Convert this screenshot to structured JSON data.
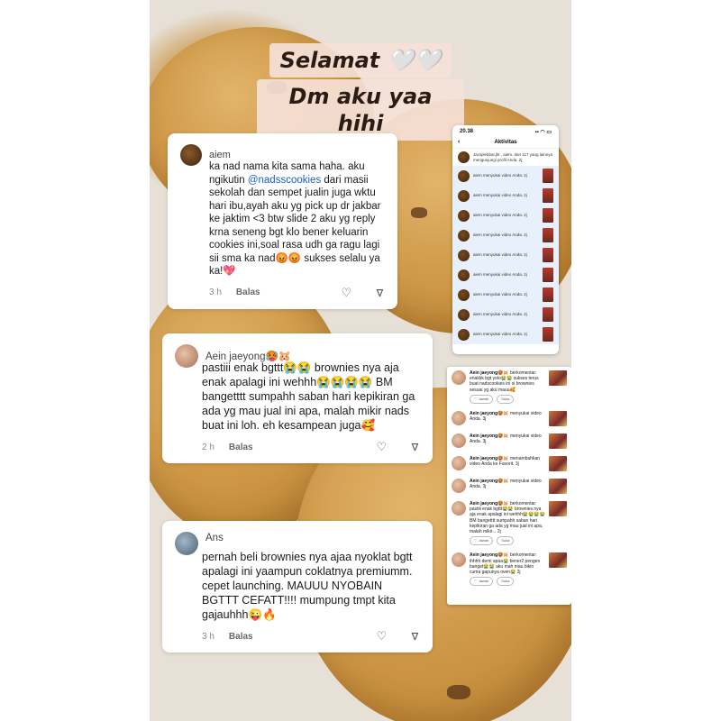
{
  "header": {
    "line1": "Selamat 🤍🤍",
    "line2": "Dm aku yaa hihi"
  },
  "comments": [
    {
      "name": "aiem",
      "text_before": "ka nad nama kita sama haha. aku ngikutin ",
      "mention": "@nadsscookies",
      "text_after": " dari masii sekolah dan sempet jualin juga wktu hari ibu,ayah aku yg pick up dr jakbar ke jaktim <3 btw slide 2 aku yg reply krna seneng bgt klo bener keluarin cookies ini,soal rasa udh ga ragu lagi sii sma ka nad😡😡 sukses selalu ya ka!💖",
      "time": "3 h",
      "reply": "Balas"
    },
    {
      "name": "Aein jaeyong🥵🐹",
      "text": "pastiii enak bgttt😭😭 brownies nya aja enak apalagi ini wehhh😭😭😭😭 BM bangetttt sumpahh saban hari kepikiran ga ada yg mau jual ini apa, malah mikir nads buat ini loh. eh kesampean juga🥰",
      "time": "2 h",
      "reply": "Balas"
    },
    {
      "name": "Ans",
      "text": "pernah beli brownies nya ajaa nyoklat bgtt apalagi ini yaampun coklatnya premiumm. cepet launching. MAUUU NYOBAIN BGTTT CEFATT!!!! mumpung tmpt kita gajauhhh😜🔥",
      "time": "3 h",
      "reply": "Balas"
    }
  ],
  "phone": {
    "time": "20.38",
    "status_icons": "▪▪ ◠ ▭",
    "title": "Aktivitas",
    "back_icon": "‹",
    "first_row": "Jaciiplebbar.jkt , aiem, dan 117 yang lainnya mengunjungi profil Anda. 2j",
    "rows": [
      "aiem menyukai video Anda. 2j",
      "aiem menyukai video Anda. 2j",
      "aiem menyukai video Anda. 2j",
      "aiem menyukai video Anda. 2j",
      "aiem menyukai video Anda. 2j",
      "aiem menyukai video Anda. 2j",
      "aiem menyukai video Anda. 2j",
      "aiem menyukai video Anda. 2j",
      "aiem menyukai video Anda. 2j"
    ]
  },
  "activity": {
    "items": [
      {
        "name": "Aein jaeyong🥵🐹",
        "text": "berkomentar: enakkk bgt yolo😭😭 sukses terus buat nadscookies ini si brownies sesuai yg aku mauu🥰",
        "buttons": [
          "♡ Jawab",
          "Suka"
        ]
      },
      {
        "name": "Aein jaeyong🥵🐹",
        "text": "menyukai video Anda. 3j",
        "buttons": []
      },
      {
        "name": "Aein jaeyong🥵🐹",
        "text": "menyukai video Anda. 3j",
        "buttons": []
      },
      {
        "name": "Aein jaeyong🥵🐹",
        "text": "menambahkan video Anda ke Favorit. 3j",
        "buttons": []
      },
      {
        "name": "Aein jaeyong🥵🐹",
        "text": "menyukai video Anda. 3j",
        "buttons": []
      },
      {
        "name": "Aein jaeyong🥵🐹",
        "text": "berkomentar: pastiii enak bgttt😭😭 brownies nya aja enak apalagi ini wehhh😭😭😭😭 BM bangetttt sumpahh saban hari kepikiran ga ada yg mau jual ini apa, malah mikir... 2j",
        "buttons": [
          "♡ Jawab",
          "Suka"
        ]
      },
      {
        "name": "Aein jaeyong🥵🐹",
        "text": "berkomentar: ihhhh demi apaa😭 bener2 pengen banget😭😭 aku mah mau bikin cuma gapunya oven😭 2j",
        "buttons": [
          "♡ Jawab",
          "Suka"
        ]
      }
    ]
  },
  "icons": {
    "like": "♡",
    "dislike": "⊲"
  }
}
